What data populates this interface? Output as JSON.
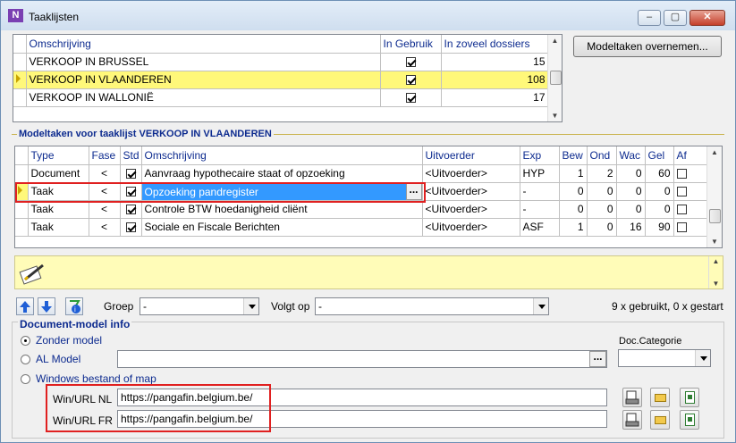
{
  "window": {
    "title": "Taaklijsten",
    "icon": "app-logo-icon"
  },
  "takenlijst": {
    "columns": [
      "Omschrijving",
      "In Gebruik",
      "In zoveel dossiers"
    ],
    "rows": [
      {
        "omschrijving": "VERKOOP IN BRUSSEL",
        "in_gebruik": true,
        "dossiers": "15"
      },
      {
        "omschrijving": "VERKOOP IN VLAANDEREN",
        "in_gebruik": true,
        "dossiers": "108",
        "selected": true
      },
      {
        "omschrijving": "VERKOOP IN WALLONIË",
        "in_gebruik": true,
        "dossiers": "17"
      }
    ]
  },
  "buttons": {
    "modeltaken_overnemen": "Modeltaken overnemen..."
  },
  "modeltaken": {
    "section_title": "Modeltaken voor taaklijst VERKOOP IN VLAANDEREN",
    "columns": [
      "Type",
      "Fase",
      "Std",
      "Omschrijving",
      "Uitvoerder",
      "Exp",
      "Bew",
      "Ond",
      "Wac",
      "Gel",
      "Af"
    ],
    "rows": [
      {
        "type": "Document",
        "fase": "<",
        "std": true,
        "omschrijving": "Aanvraag hypothecaire staat of opzoeking",
        "uitvoerder": "<Uitvoerder>",
        "exp": "HYP",
        "bew": "1",
        "ond": "2",
        "wac": "0",
        "gel": "60",
        "af": false
      },
      {
        "type": "Taak",
        "fase": "<",
        "std": true,
        "omschrijving": "Opzoeking pandregister",
        "uitvoerder": "<Uitvoerder>",
        "exp": "-",
        "bew": "0",
        "ond": "0",
        "wac": "0",
        "gel": "0",
        "af": false,
        "selected": true
      },
      {
        "type": "Taak",
        "fase": "<",
        "std": true,
        "omschrijving": "Controle BTW hoedanigheid cliënt",
        "uitvoerder": "<Uitvoerder>",
        "exp": "-",
        "bew": "0",
        "ond": "0",
        "wac": "0",
        "gel": "0",
        "af": false
      },
      {
        "type": "Taak",
        "fase": "<",
        "std": true,
        "omschrijving": "Sociale en Fiscale Berichten",
        "uitvoerder": "<Uitvoerder>",
        "exp": "ASF",
        "bew": "1",
        "ond": "0",
        "wac": "16",
        "gel": "90",
        "af": false
      }
    ],
    "ellipsis": "..."
  },
  "toolbar": {
    "groep_label": "Groep",
    "groep_value": "-",
    "volgtop_label": "Volgt op",
    "volgtop_value": "-",
    "usage_text": "9 x gebruikt, 0 x gestart"
  },
  "docmodel": {
    "section_title": "Document-model info",
    "radio_zonder": "Zonder model",
    "radio_al": "AL Model",
    "radio_windows": "Windows bestand of map",
    "doc_categorie_label": "Doc.Categorie",
    "doc_categorie_value": "",
    "al_model_value": "",
    "win_nl_label": "Win/URL NL",
    "win_nl_value": "https://pangafin.belgium.be/",
    "win_fr_label": "Win/URL FR",
    "win_fr_value": "https://pangafin.belgium.be/",
    "selected_radio": "Zonder model"
  },
  "colors": {
    "highlight_row": "#fff87a",
    "selection_blue": "#3399ff",
    "section_title": "#0d2b8f",
    "annotation_red": "#e02020"
  }
}
